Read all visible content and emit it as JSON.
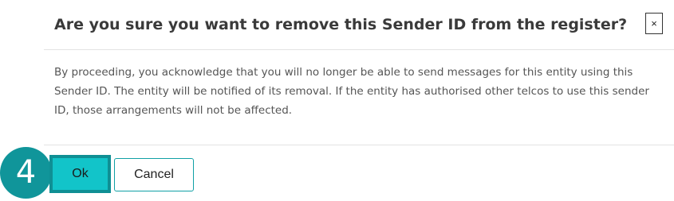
{
  "dialog": {
    "title": "Are you sure you want to remove this Sender ID from the register?",
    "close_label": "×",
    "body": "By proceeding, you acknowledge that you will no longer be able to send messages for this entity using this Sender ID. The entity will be notified of its removal. If the entity has authorised other telcos to use this sender ID, those arrangements will not be affected.",
    "ok_label": "Ok",
    "cancel_label": "Cancel"
  },
  "step_badge": {
    "number": "4"
  },
  "colors": {
    "accent": "#12c4c9",
    "accent_dark": "#0f8f94",
    "badge": "#10959a"
  }
}
